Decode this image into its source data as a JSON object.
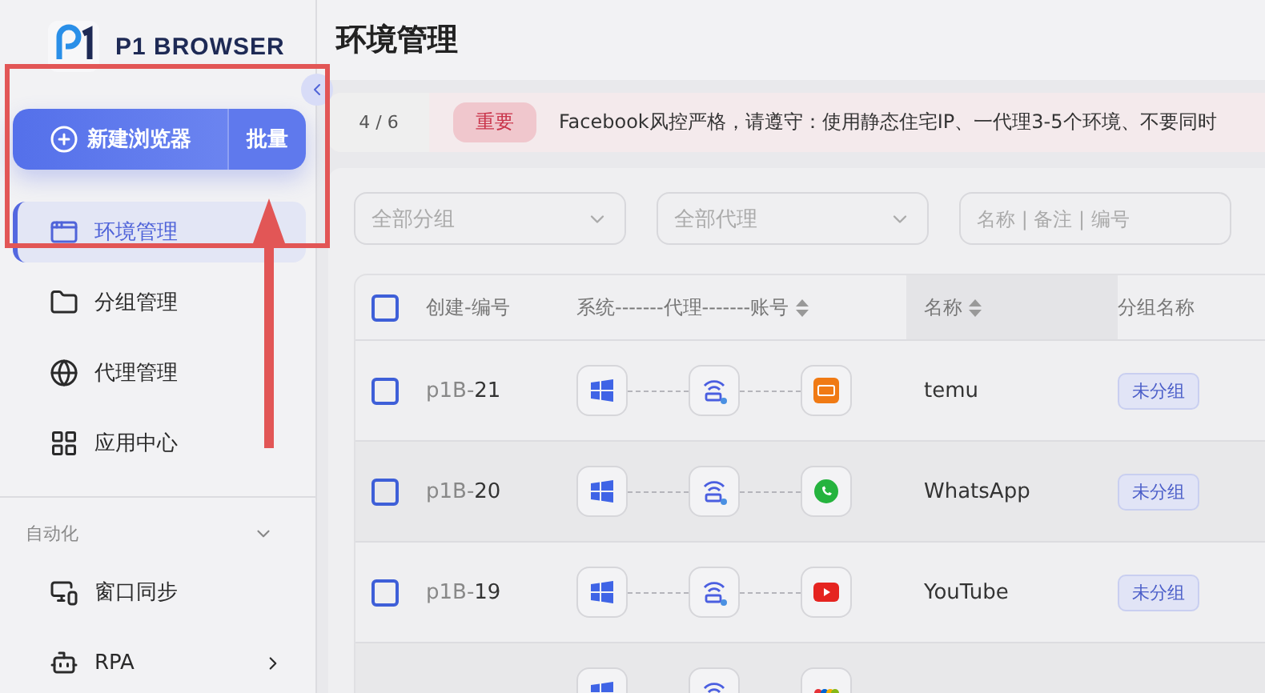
{
  "logo": {
    "text": "P1 BROWSER"
  },
  "new_browser_button": {
    "label": "新建浏览器"
  },
  "batch_button": {
    "label": "批量"
  },
  "nav": [
    {
      "label": "环境管理",
      "selected": true
    },
    {
      "label": "分组管理",
      "selected": false
    },
    {
      "label": "代理管理",
      "selected": false
    },
    {
      "label": "应用中心",
      "selected": false
    }
  ],
  "automation": {
    "label": "自动化",
    "expanded": true,
    "items": [
      {
        "label": "窗口同步",
        "has_submenu": false
      },
      {
        "label": "RPA",
        "has_submenu": true
      }
    ]
  },
  "page_title": "环境管理",
  "notice": {
    "counter": "4 / 6",
    "tag": "重要",
    "text": "Facebook风控严格，请遵守：使用静态住宅IP、一代理3-5个环境、不要同时"
  },
  "filters": [
    {
      "placeholder": "全部分组",
      "kind": "select"
    },
    {
      "placeholder": "全部代理",
      "kind": "select"
    },
    {
      "placeholder": "名称 | 备注 | 编号",
      "kind": "search"
    }
  ],
  "table": {
    "all_checked": false,
    "columns": [
      {
        "label": "创建-编号",
        "sortable": false
      },
      {
        "label": "系统-------代理-------账号",
        "sortable": true
      },
      {
        "label": "名称",
        "sortable": true
      },
      {
        "label": "分组名称",
        "sortable": false
      }
    ],
    "rows": [
      {
        "checked": false,
        "id_prefix": "p1B-",
        "id_number": "21",
        "name": "temu",
        "group": "未分组"
      },
      {
        "checked": false,
        "id_prefix": "p1B-",
        "id_number": "20",
        "name": "WhatsApp",
        "group": "未分组"
      },
      {
        "checked": false,
        "id_prefix": "p1B-",
        "id_number": "19",
        "name": "YouTube",
        "group": "未分组"
      }
    ]
  }
}
